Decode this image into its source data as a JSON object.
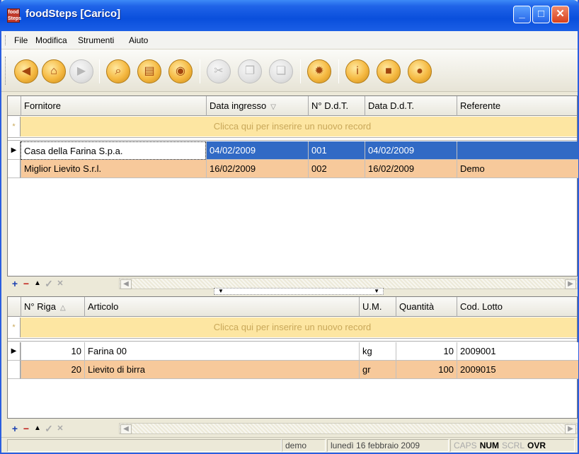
{
  "window": {
    "title": "foodSteps [Carico]",
    "icon_label": "food Steps",
    "minimize_label": "_",
    "maximize_label": "□",
    "close_label": "✕"
  },
  "menu": [
    "File",
    "Modifica",
    "Strumenti",
    "Aiuto"
  ],
  "toolbar": {
    "buttons": [
      {
        "icon": "back-arrow-icon",
        "glyph": "◀",
        "enabled": true
      },
      {
        "icon": "home-icon",
        "glyph": "⌂",
        "enabled": true
      },
      {
        "icon": "forward-arrow-icon",
        "glyph": "▶",
        "enabled": false
      },
      {
        "icon": "search-icon",
        "glyph": "⌕",
        "enabled": true
      },
      {
        "icon": "print-icon",
        "glyph": "▤",
        "enabled": true
      },
      {
        "icon": "print-preview-icon",
        "glyph": "◉",
        "enabled": true
      },
      {
        "icon": "cut-icon",
        "glyph": "✂",
        "enabled": false
      },
      {
        "icon": "copy-icon",
        "glyph": "❐",
        "enabled": false
      },
      {
        "icon": "paste-icon",
        "glyph": "❏",
        "enabled": false
      },
      {
        "icon": "settings-gear-icon",
        "glyph": "✹",
        "enabled": true
      },
      {
        "icon": "info-icon",
        "glyph": "i",
        "enabled": true
      },
      {
        "icon": "box-icon",
        "glyph": "■",
        "enabled": true
      },
      {
        "icon": "users-icon",
        "glyph": "●",
        "enabled": true
      }
    ]
  },
  "top_grid": {
    "columns": [
      "Fornitore",
      "Data ingresso",
      "N° D.d.T.",
      "Data D.d.T.",
      "Referente"
    ],
    "sort_indicator": "▽",
    "new_record_text": "Clicca qui per inserire un nuovo record",
    "rows": [
      {
        "fornitore": "Casa della Farina S.p.a.",
        "data_ingresso": "04/02/2009",
        "ddt": "001",
        "data_ddt": "04/02/2009",
        "referente": ""
      },
      {
        "fornitore": "Miglior Lievito S.r.l.",
        "data_ingresso": "16/02/2009",
        "ddt": "002",
        "data_ddt": "16/02/2009",
        "referente": "Demo"
      }
    ]
  },
  "bottom_grid": {
    "columns": [
      "N° Riga",
      "Articolo",
      "U.M.",
      "Quantità",
      "Cod. Lotto"
    ],
    "sort_indicator": "△",
    "new_record_text": "Clicca qui per inserire un nuovo record",
    "rows": [
      {
        "riga": "10",
        "articolo": "Farina 00",
        "um": "kg",
        "quantita": "10",
        "lotto": "2009001"
      },
      {
        "riga": "20",
        "articolo": "Lievito di birra",
        "um": "gr",
        "quantita": "100",
        "lotto": "2009015"
      }
    ]
  },
  "navigator": {
    "add": "+",
    "remove": "−",
    "up": "▲",
    "confirm": "✓",
    "cancel": "✕",
    "left": "◀",
    "right": "▶"
  },
  "splitter": {
    "left": "▼",
    "right": "▼"
  },
  "statusbar": {
    "user": "demo",
    "date": "lunedì 16 febbraio 2009",
    "caps": "CAPS",
    "num": "NUM",
    "scrl": "SCRL",
    "ovr": "OVR"
  },
  "colors": {
    "title_bar": "#0a4fdc",
    "selected_row": "#316ac5",
    "alt_row": "#f7c99b",
    "new_record_row": "#fde6a2"
  }
}
